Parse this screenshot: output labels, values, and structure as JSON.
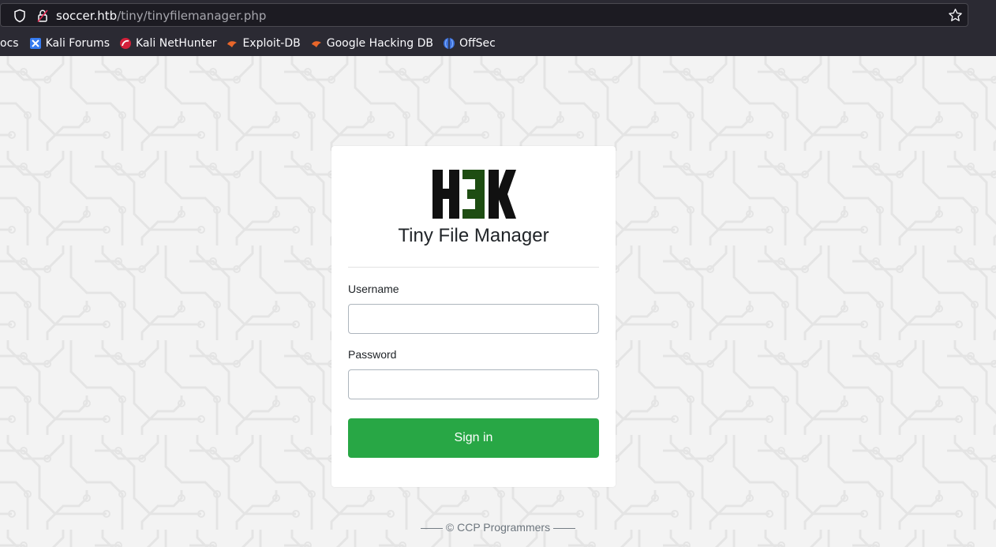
{
  "browser": {
    "url_host": "soccer.htb",
    "url_path": "/tiny/tinyfilemanager.php",
    "bookmarks": [
      {
        "label": "ocs",
        "icon": "none"
      },
      {
        "label": "Kali Forums",
        "icon": "kali-forums-icon"
      },
      {
        "label": "Kali NetHunter",
        "icon": "kali-nethunter-icon"
      },
      {
        "label": "Exploit-DB",
        "icon": "exploit-db-icon"
      },
      {
        "label": "Google Hacking DB",
        "icon": "google-hacking-db-icon"
      },
      {
        "label": "OffSec",
        "icon": "offsec-icon"
      }
    ]
  },
  "login": {
    "logo_text": "H3K",
    "app_title": "Tiny File Manager",
    "username_label": "Username",
    "username_value": "",
    "password_label": "Password",
    "password_value": "",
    "submit_label": "Sign in"
  },
  "footer": {
    "text": "—— © CCP Programmers ——"
  },
  "colors": {
    "accent_green": "#28a745",
    "logo_dark": "#111111",
    "logo_green": "#1e4d12",
    "chrome_bg": "#2b2a33"
  }
}
